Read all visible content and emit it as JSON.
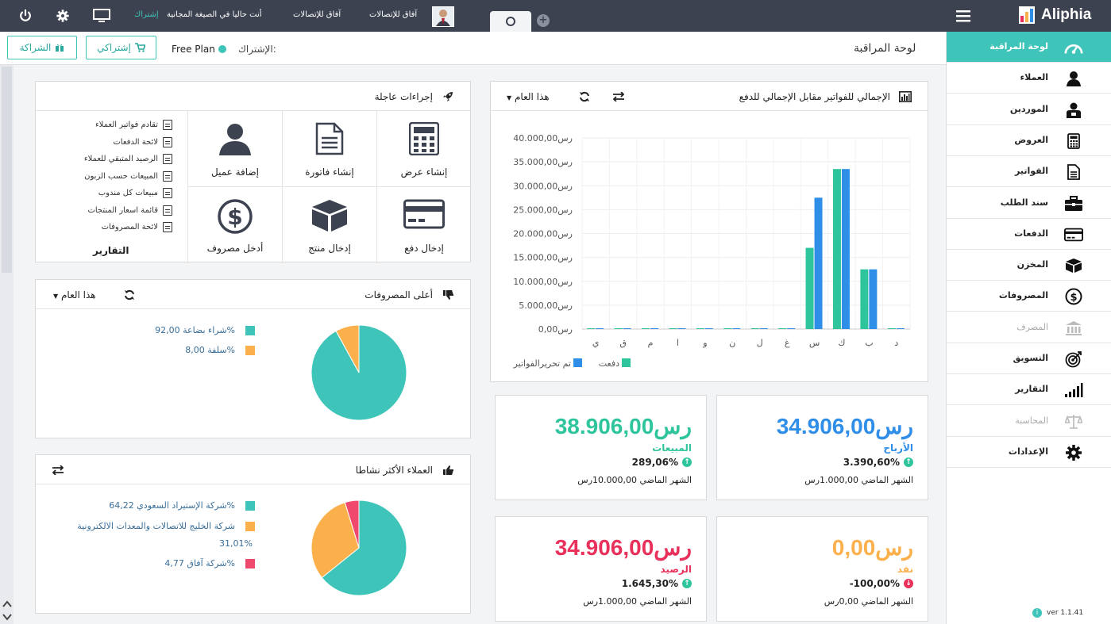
{
  "app": {
    "name": "Aliphia",
    "version": "ver 1.1.41"
  },
  "topbar": {
    "user_name": "آفاق للإتصالات",
    "company_name": "آفاق للإتصالات",
    "plan_notice": "أنت حاليا في الصيغة المجانية",
    "subscribe_link": "إشتراك"
  },
  "header": {
    "page_title": "لوحة المراقبة",
    "subscription_label": "الإشتراك:",
    "plan_name": "Free Plan",
    "subscriptions_button": "إشتراكي",
    "partnership_button": "الشراكة"
  },
  "sidebar": {
    "items": [
      {
        "label": "لوحة المراقبة",
        "icon": "dashboard-icon",
        "active": true
      },
      {
        "label": "العملاء",
        "icon": "user-icon"
      },
      {
        "label": "الموردين",
        "icon": "supplier-icon"
      },
      {
        "label": "العروض",
        "icon": "calculator-icon"
      },
      {
        "label": "الفواتير",
        "icon": "invoice-icon"
      },
      {
        "label": "سند الطلب",
        "icon": "briefcase-icon"
      },
      {
        "label": "الدفعات",
        "icon": "credit-card-icon"
      },
      {
        "label": "المخزن",
        "icon": "box-icon"
      },
      {
        "label": "المصروفات",
        "icon": "dollar-icon"
      },
      {
        "label": "المصرف",
        "icon": "bank-icon",
        "disabled": true
      },
      {
        "label": "التسويق",
        "icon": "target-icon"
      },
      {
        "label": "التقارير",
        "icon": "bar-chart-icon"
      },
      {
        "label": "المحاسبة",
        "icon": "scale-icon",
        "disabled": true
      },
      {
        "label": "الإعدادات",
        "icon": "gear-icon"
      }
    ]
  },
  "quick_actions": {
    "title": "إجراءات عاجلة",
    "actions": [
      {
        "label": "إنشاء عرض",
        "icon": "calculator-icon"
      },
      {
        "label": "إنشاء فاتورة",
        "icon": "document-icon"
      },
      {
        "label": "إضافة عميل",
        "icon": "user-icon"
      },
      {
        "label": "إدخال دفع",
        "icon": "credit-card-icon"
      },
      {
        "label": "إدخال منتج",
        "icon": "box-icon"
      },
      {
        "label": "أدخل مصروف",
        "icon": "dollar-icon"
      }
    ],
    "reports_title": "التقارير",
    "reports": [
      "تقادم فواتير العملاء",
      "لائحة الدفعات",
      "الرصيد المتبقي للعملاء",
      "المبيعات حسب الزبون",
      "مبيعات كل مندوب",
      "قائمة اسعار المنتجات",
      "لائحة المصروفات"
    ]
  },
  "expenses_panel": {
    "title": "أعلى المصروفات",
    "period": "هذا العام",
    "legend": [
      {
        "label": "شراء بضاعة 92,00%",
        "color": "#3ec4b8"
      },
      {
        "label": "سلفة 8,00%",
        "color": "#fbb04c"
      }
    ]
  },
  "customers_panel": {
    "title": "العملاء الأكثر نشاطا",
    "legend": [
      {
        "label": "شركة الإستيراد السعودي 64,22%",
        "color": "#3ec4b8"
      },
      {
        "label": "شركة الخليج للاتصالات والمعدات الالكترونية",
        "label2": "31,01%",
        "color": "#fbb04c"
      },
      {
        "label": "شركة آفاق 4,77%",
        "color": "#ef4a6e"
      }
    ]
  },
  "chart_panel": {
    "title": "الإجمالي للفواتير مقابل الإجمالي للدفع",
    "period": "هذا العام"
  },
  "chart_data": [
    {
      "type": "bar",
      "title": "الإجمالي للفواتير مقابل الإجمالي للدفع",
      "categories": [
        "ي",
        "ق",
        "م",
        "ا",
        "و",
        "ن",
        "ل",
        "غ",
        "س",
        "ك",
        "ب",
        "د"
      ],
      "series": [
        {
          "name": "دفعت",
          "color": "#2ec49c",
          "values": [
            0,
            0,
            0,
            0,
            0,
            0,
            0,
            0,
            17000,
            33500,
            12500,
            0
          ]
        },
        {
          "name": "تم تحريرالفواتير",
          "color": "#2f8ee8",
          "values": [
            0,
            0,
            0,
            0,
            0,
            0,
            0,
            0,
            27500,
            33500,
            12500,
            0
          ]
        }
      ],
      "y_ticks": [
        "40.000,00رس",
        "35.000,00رس",
        "30.000,00رس",
        "25.000,00رس",
        "20.000,00رس",
        "15.000,00رس",
        "10.000,00رس",
        "5.000,00رس",
        "0,00رس"
      ],
      "ylim": [
        0,
        40000
      ],
      "grid": true,
      "legend_position": "bottom"
    },
    {
      "type": "pie",
      "title": "أعلى المصروفات",
      "labels": [
        "شراء بضاعة",
        "سلفة"
      ],
      "values": [
        92.0,
        8.0
      ],
      "colors": [
        "#3ec4b8",
        "#fbb04c"
      ]
    },
    {
      "type": "pie",
      "title": "العملاء الأكثر نشاطا",
      "labels": [
        "شركة الإستيراد السعودي",
        "شركة الخليج للاتصالات والمعدات الالكترونية",
        "شركة آفاق"
      ],
      "values": [
        64.22,
        31.01,
        4.77
      ],
      "colors": [
        "#3ec4b8",
        "#fbb04c",
        "#ef4a6e"
      ]
    }
  ],
  "stats": [
    {
      "value": "34.906,00رس",
      "label": "الأرباح",
      "pct": "3.390,60%",
      "prev": "الشهر الماضي 1.000,00رس",
      "color": "#2f8ee8",
      "trend": "up"
    },
    {
      "value": "38.906,00رس",
      "label": "المبيعات",
      "pct": "289,06%",
      "prev": "الشهر الماضي 10.000,00رس",
      "color": "#2ec49c",
      "trend": "up"
    },
    {
      "value": "0,00رس",
      "label": "نقد",
      "pct": "-100,00%",
      "prev": "الشهر الماضي 0,00رس",
      "color": "#fbb04c",
      "trend": "down"
    },
    {
      "value": "34.906,00رس",
      "label": "الرصيد",
      "pct": "1.645,30%",
      "prev": "الشهر الماضي 1.000,00رس",
      "color": "#e8305b",
      "trend": "up"
    }
  ]
}
